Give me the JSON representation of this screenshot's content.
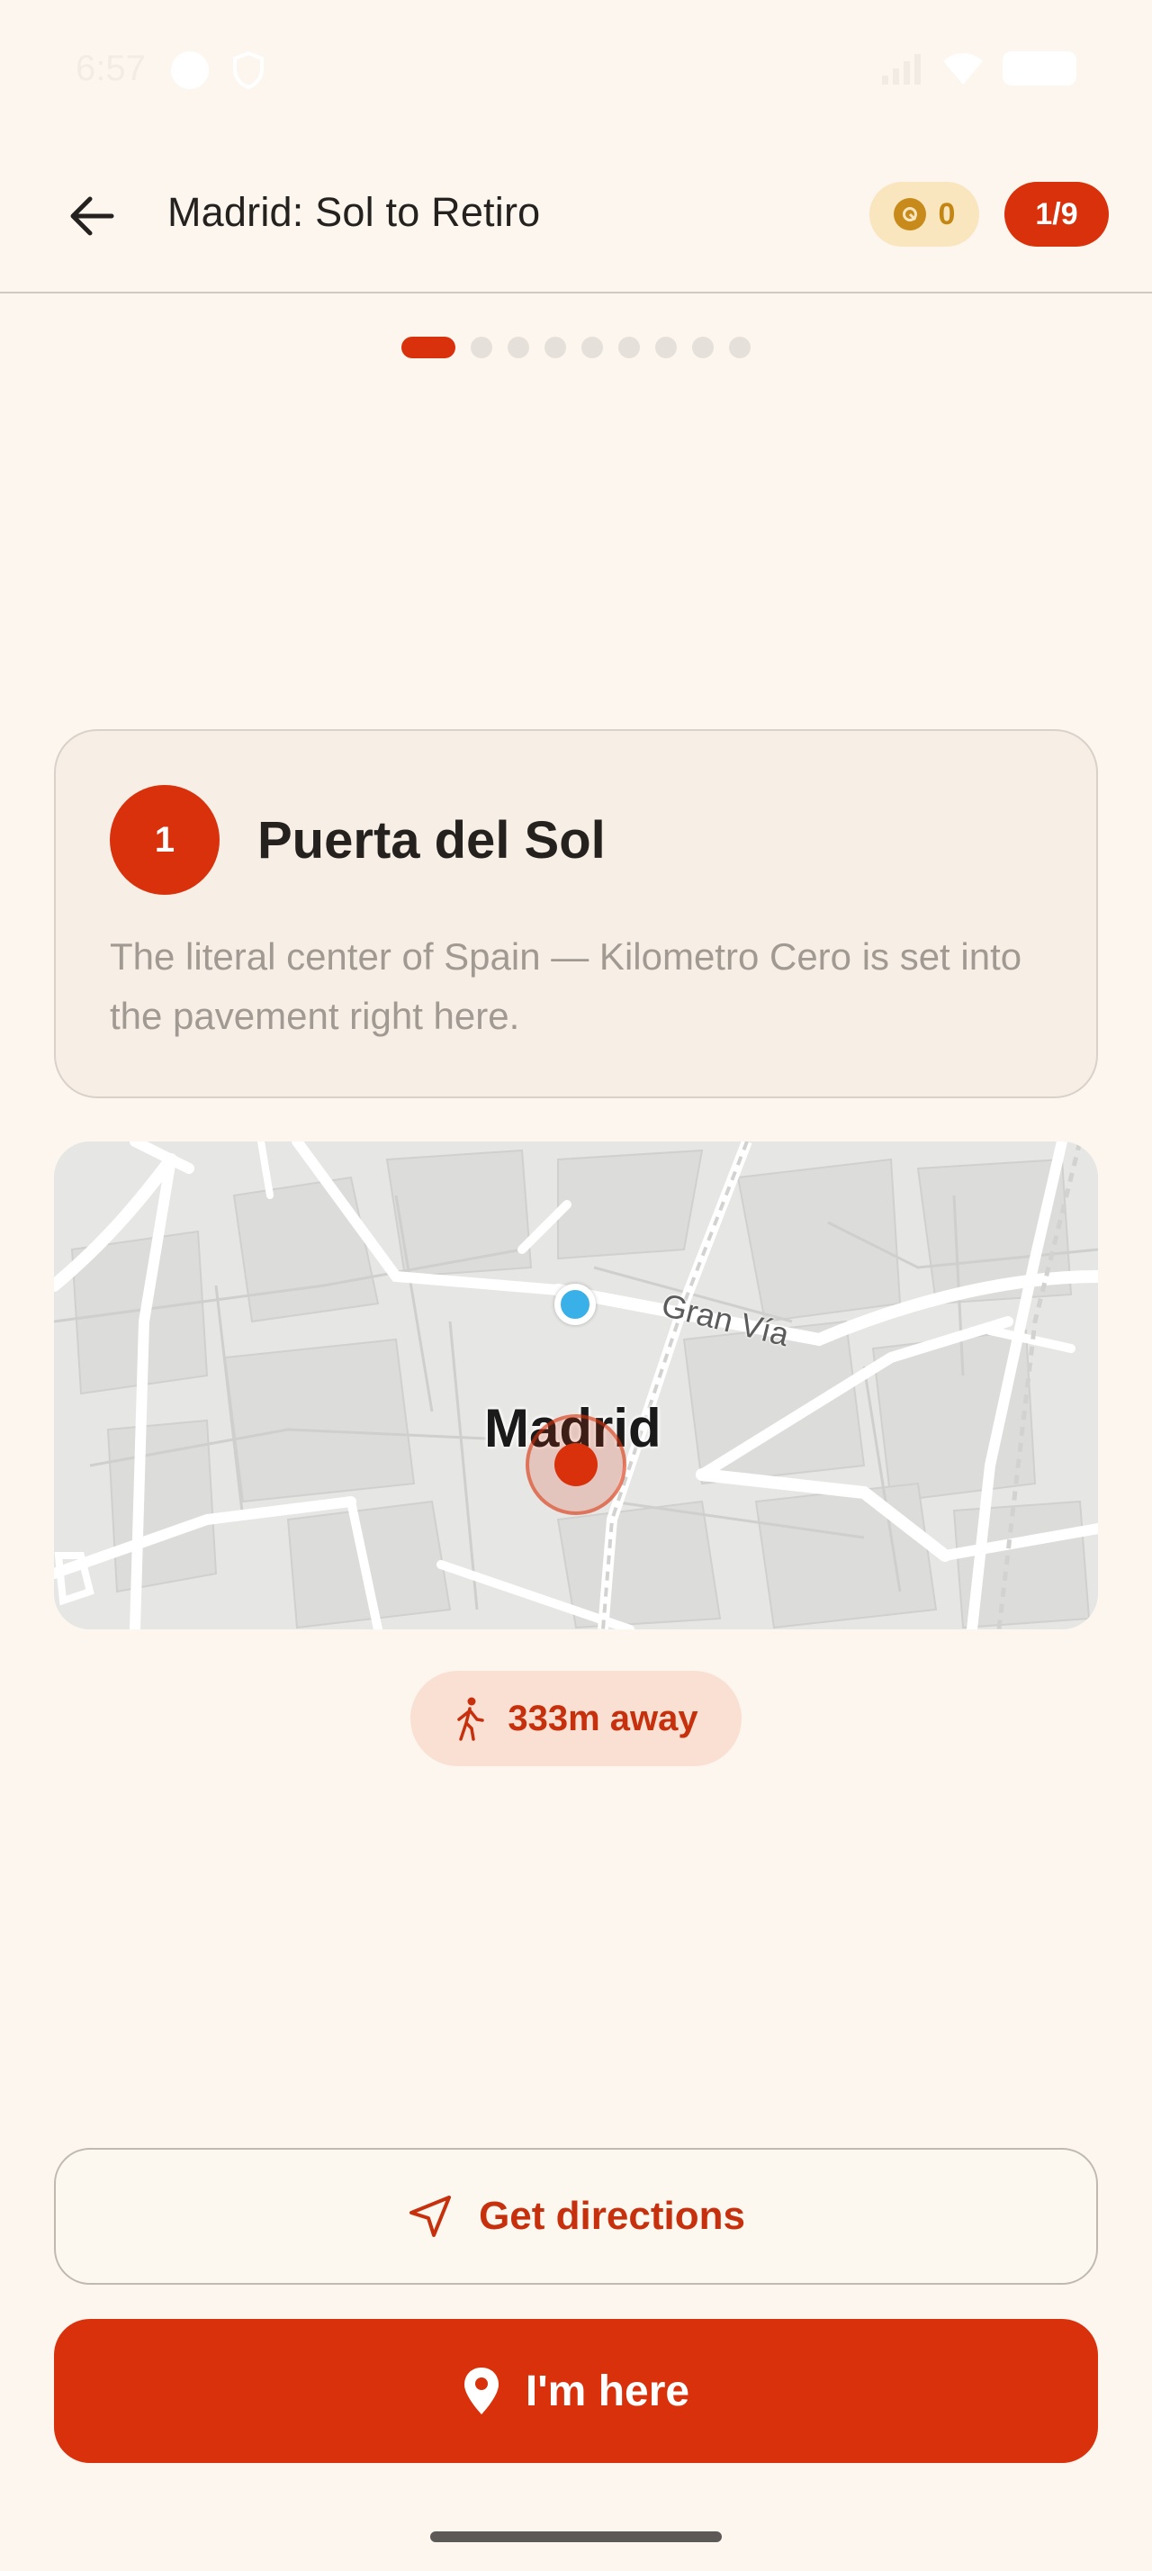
{
  "status_bar": {
    "time": "6:57"
  },
  "header": {
    "title": "Madrid: Sol to Retiro",
    "points": "0",
    "progress": "1/9",
    "back_icon": "arrow-left-icon",
    "coin_icon": "coin-icon"
  },
  "stepper": {
    "total": 9,
    "current": 1
  },
  "stop": {
    "number": "1",
    "name": "Puerta del Sol",
    "description": "The literal center of Spain — Kilometro Cero is set into the pavement right here."
  },
  "map": {
    "city_label": "Madrid",
    "street_label": "Gran Vía"
  },
  "distance": {
    "text": "333m away",
    "icon": "walking-icon"
  },
  "actions": {
    "directions_label": "Get directions",
    "directions_icon": "navigation-arrow-icon",
    "here_label": "I'm here",
    "here_icon": "map-pin-icon"
  },
  "colors": {
    "accent": "#d8310b",
    "background": "#fcf6ef",
    "card": "#f7efe6",
    "points_badge": "#f9e6bf",
    "user_location": "#3ab0e8"
  }
}
